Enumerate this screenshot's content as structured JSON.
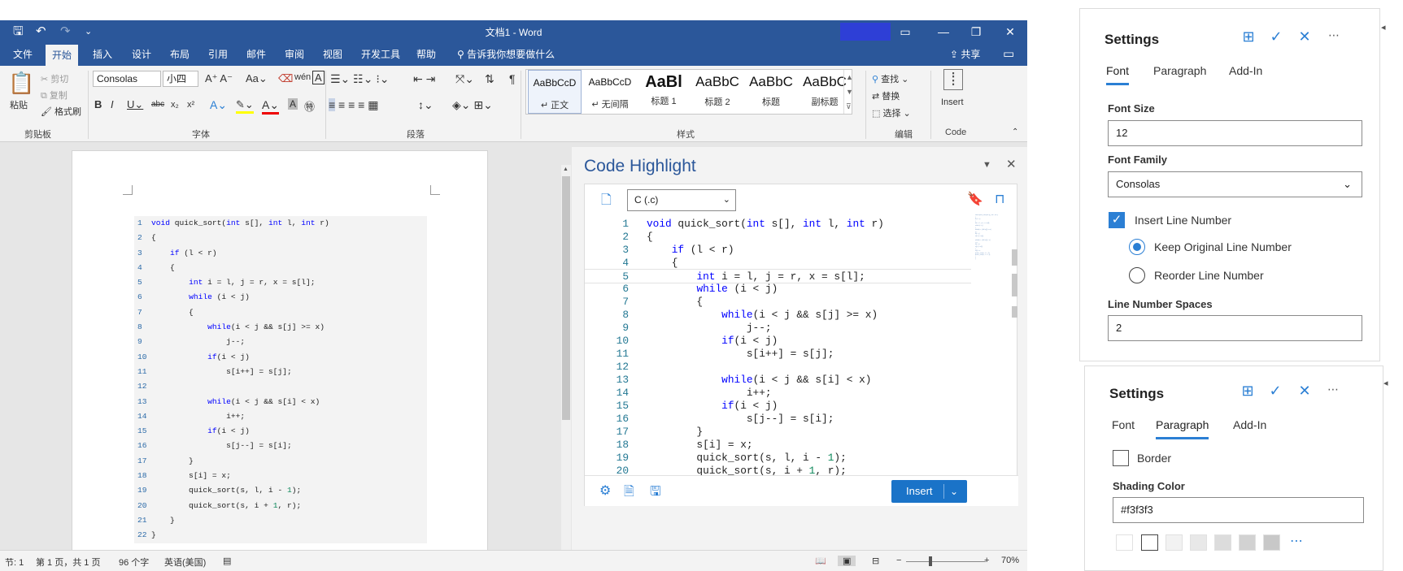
{
  "window": {
    "title": "文档1 - Word",
    "minimize": "—",
    "restore": "❐",
    "close": "✕",
    "ribbon_display": "▭"
  },
  "quick_access": {
    "save": "🖫",
    "undo": "↶",
    "redo": "↷",
    "customize": "⌄"
  },
  "menu": {
    "items": [
      "文件",
      "开始",
      "插入",
      "设计",
      "布局",
      "引用",
      "邮件",
      "审阅",
      "视图",
      "开发工具",
      "帮助"
    ],
    "active": "开始",
    "tell_me": "告诉我你想要做什么",
    "share": "共享"
  },
  "ribbon": {
    "clipboard": {
      "paste": "粘贴",
      "cut": "剪切",
      "copy": "复制",
      "format_painter": "格式刷",
      "label": "剪贴板"
    },
    "font": {
      "family": "Consolas",
      "size": "小四",
      "label": "字体"
    },
    "paragraph": {
      "label": "段落"
    },
    "styles": {
      "label": "样式",
      "items": [
        {
          "preview": "AaBbCcD",
          "name": "↵ 正文"
        },
        {
          "preview": "AaBbCcD",
          "name": "↵ 无间隔"
        },
        {
          "preview": "AaBl",
          "name": "标题 1"
        },
        {
          "preview": "AaBbC",
          "name": "标题 2"
        },
        {
          "preview": "AaBbC",
          "name": "标题"
        },
        {
          "preview": "AaBbC",
          "name": "副标题"
        }
      ]
    },
    "editing": {
      "find": "查找",
      "replace": "替换",
      "select": "选择",
      "label": "编辑"
    },
    "code": {
      "insert": "Insert",
      "label": "Code"
    }
  },
  "document_code": [
    "void quick_sort(int s[], int l, int r)",
    "{",
    "    if (l < r)",
    "    {",
    "        int i = l, j = r, x = s[l];",
    "        while (i < j)",
    "        {",
    "            while(i < j && s[j] >= x)",
    "                j--;",
    "            if(i < j)",
    "                s[i++] = s[j];",
    "",
    "            while(i < j && s[i] < x)",
    "                i++;",
    "            if(i < j)",
    "                s[j--] = s[i];",
    "        }",
    "        s[i] = x;",
    "        quick_sort(s, l, i - 1);",
    "        quick_sort(s, i + 1, r);",
    "    }",
    "}"
  ],
  "code_highlight": {
    "title": "Code Highlight",
    "language": "C (.c)",
    "insert_button": "Insert",
    "current_line": 5,
    "visible_lines": 20,
    "partial_line": "        quick_sort(s, i + 1, r);"
  },
  "status_bar": {
    "section": "节: 1",
    "page": "第 1 页，共 1 页",
    "words": "96 个字",
    "language": "英语(美国)",
    "zoom": "70%"
  },
  "settings_font": {
    "title": "Settings",
    "tabs": [
      "Font",
      "Paragraph",
      "Add-In"
    ],
    "active_tab": "Font",
    "font_size_label": "Font Size",
    "font_size": "12",
    "font_family_label": "Font Family",
    "font_family": "Consolas",
    "insert_line_number": "Insert Line Number",
    "keep_original": "Keep Original Line Number",
    "reorder": "Reorder Line Number",
    "line_number_spaces_label": "Line Number Spaces",
    "line_number_spaces": "2"
  },
  "settings_paragraph": {
    "title": "Settings",
    "tabs": [
      "Font",
      "Paragraph",
      "Add-In"
    ],
    "active_tab": "Paragraph",
    "border": "Border",
    "shading_color_label": "Shading Color",
    "shading_color": "#f3f3f3",
    "swatches": [
      "#ffffff",
      "#ffffff",
      "#f2f2f2",
      "#e8e8e8",
      "#dcdcdc",
      "#d2d2d2",
      "#c8c8c8"
    ]
  },
  "colors": {
    "word_blue": "#2b579a",
    "accent": "#2b7fd4",
    "keyword": "#0000ff",
    "number": "#098658"
  }
}
